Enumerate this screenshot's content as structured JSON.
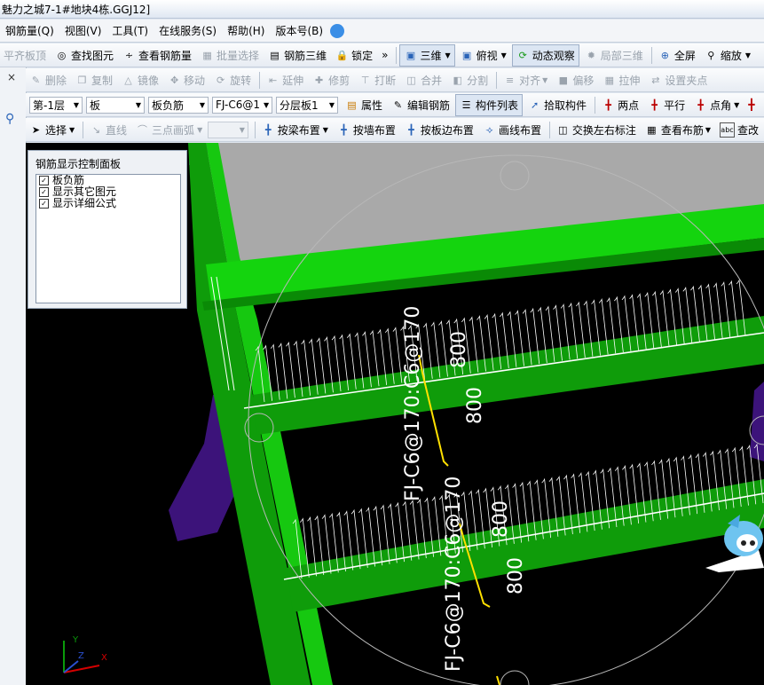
{
  "window": {
    "title": "魅力之城7-1#地块4栋.GGJ12]"
  },
  "menu": [
    "钢筋量(Q)",
    "视图(V)",
    "工具(T)",
    "在线服务(S)",
    "帮助(H)",
    "版本号(B)"
  ],
  "toolbar1": {
    "items": [
      "平齐板顶",
      "查找图元",
      "查看钢筋量",
      "批量选择",
      "钢筋三维",
      "锁定"
    ],
    "more": "»",
    "view3d": "三维",
    "top_view": "俯视",
    "dynamic": "动态观察",
    "local3d": "局部三维",
    "fullscreen": "全屏",
    "zoom": "缩放"
  },
  "toolbar2": [
    "删除",
    "复制",
    "镜像",
    "移动",
    "旋转",
    "延伸",
    "修剪",
    "打断",
    "合并",
    "分割",
    "对齐",
    "偏移",
    "拉伸",
    "设置夹点"
  ],
  "toolbar3": {
    "floor": "第-1层",
    "type": "板",
    "subtype": "板负筋",
    "element": "FJ-C6@1",
    "layer": "分层板1",
    "props": "属性",
    "edit_rebar": "编辑钢筋",
    "component_list": "构件列表",
    "pick": "拾取构件",
    "two_points": "两点",
    "parallel": "平行",
    "point_angle": "点角"
  },
  "toolbar4": {
    "select": "选择",
    "line": "直线",
    "arc": "三点画弧",
    "by_beam": "按梁布置",
    "by_wall": "按墙布置",
    "by_edge": "按板边布置",
    "draw_line": "画线布置",
    "swap": "交换左右标注",
    "view_layout": "查看布筋",
    "modify": "查改"
  },
  "panel": {
    "title": "钢筋显示控制面板",
    "options": [
      {
        "label": "板负筋",
        "checked": true
      },
      {
        "label": "显示其它图元",
        "checked": true
      },
      {
        "label": "显示详细公式",
        "checked": true
      }
    ]
  },
  "canvas": {
    "rebar1_label": "FJ-C6@170:C6@170",
    "rebar2_label": "FJ-C6@170:C6@170",
    "dim_a": "800",
    "dim_b": "800",
    "dim_c": "800",
    "dim_d": "800",
    "axis_x": "X",
    "axis_y": "Y",
    "axis_z": "Z"
  },
  "colors": {
    "beam": "#14d40e",
    "rebar": "#ffffff",
    "label": "#ffffff",
    "negative_rebar": "#ffe000",
    "purple": "#5a1aa0",
    "background": "#000000"
  }
}
